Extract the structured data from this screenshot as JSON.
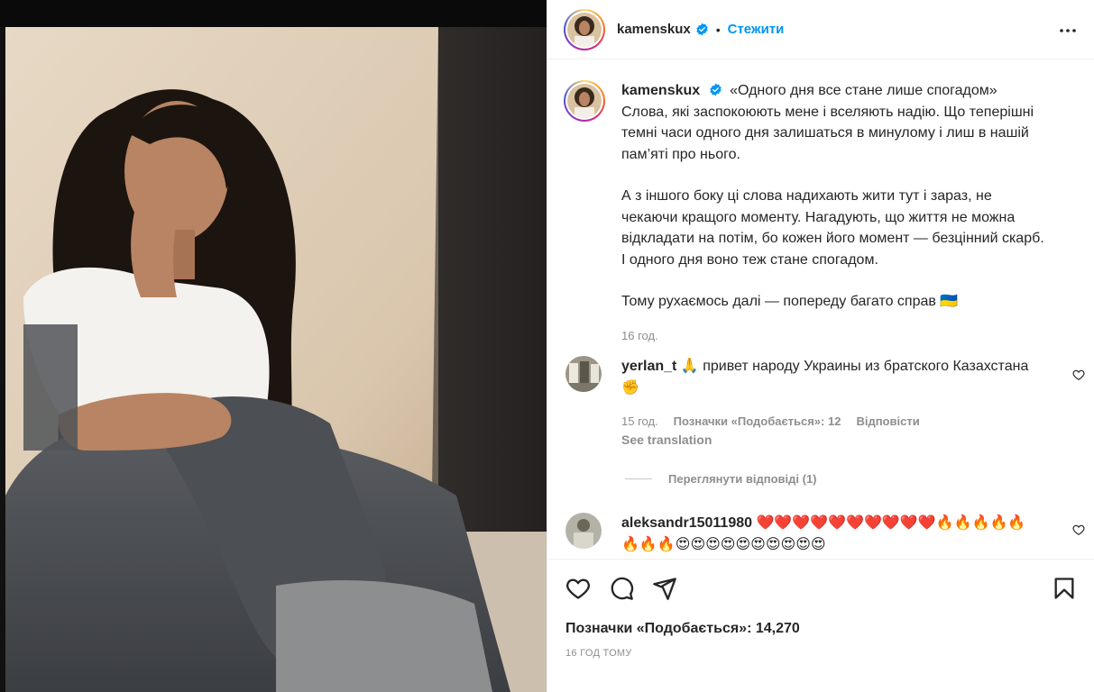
{
  "post": {
    "author": "kamenskux",
    "follow_label": "Стежити",
    "dot": "•",
    "caption_title": "«Одного дня все стане лише спогадом»",
    "caption_p1": "Слова, які заспокоюють мене і вселяють надію. Що теперішні темні часи одного дня залишаться в минулому і лиш в нашій пам’яті про нього.",
    "caption_p2": "А з іншого боку ці слова надихають жити тут і зараз, не чекаючи кращого моменту. Нагадують, що життя не можна відкладати на потім, бо кожен його момент — безцінний скарб. І одного дня воно теж стане спогадом.",
    "caption_p3": "Тому рухаємось далі — попереду багато справ 🇺🇦",
    "caption_time": "16 год.",
    "likes": "Позначки «Подобається»: 14,270",
    "posted_ago": "16 ГОД ТОМУ"
  },
  "comments": [
    {
      "user": "yerlan_t",
      "text": "🙏 привет народу Украины из братского Казахстана ✊",
      "time": "15 год.",
      "likes": "Позначки «Подобається»: 12",
      "reply": "Відповісти",
      "translation": "See translation"
    },
    {
      "user": "aleksandr15011980",
      "text": "❤️❤️❤️❤️❤️❤️❤️❤️❤️❤️🔥🔥🔥🔥🔥🔥🔥🔥😍😍😍😍😍😍😍😍😍😍"
    }
  ],
  "view_replies": "Переглянути відповіді (1)",
  "colors": {
    "accent": "#0095f6",
    "text": "#262626",
    "muted": "#8e8e8e",
    "border": "#efefef"
  },
  "icons": [
    "more-icon",
    "verified-icon",
    "heart-icon",
    "comment-icon",
    "share-icon",
    "save-icon"
  ]
}
